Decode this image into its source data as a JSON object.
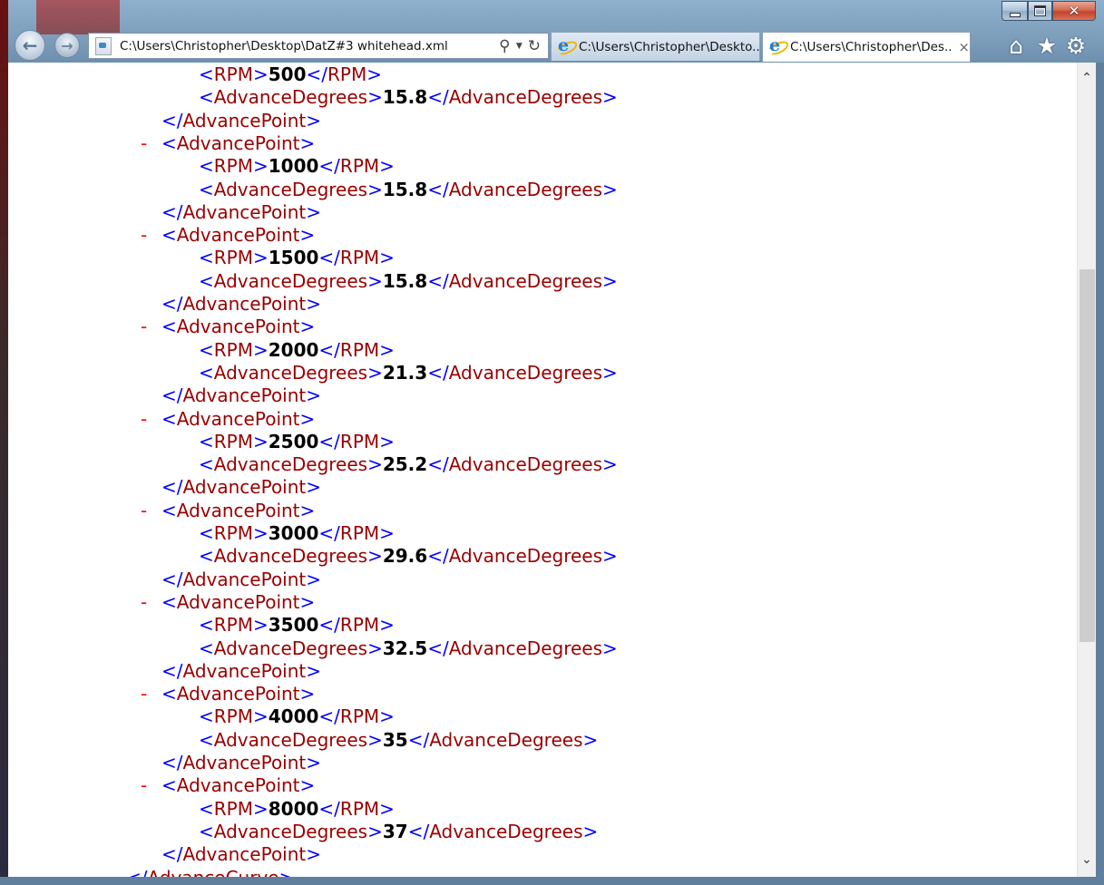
{
  "window": {
    "address": "C:\\Users\\Christopher\\Desktop\\DatZ#3 whitehead.xml",
    "close_glyph": "✕"
  },
  "tabs": [
    {
      "label": "C:\\Users\\Christopher\\Deskto...",
      "active": false
    },
    {
      "label": "C:\\Users\\Christopher\\Des...",
      "active": true
    }
  ],
  "toolbar": {
    "back_glyph": "←",
    "forward_glyph": "→",
    "home_glyph": "⌂",
    "favorites_glyph": "★",
    "tools_glyph": "⚙",
    "search_glyph": "⚲",
    "dropdown_glyph": "▼",
    "refresh_glyph": "↻",
    "tab_close_glyph": "×"
  },
  "scrollbar": {
    "up_glyph": "⌃",
    "down_glyph": "⌄"
  },
  "xml": {
    "first_rpm": "500",
    "first_deg": "15.8",
    "points": [
      {
        "rpm": "1000",
        "deg": "15.8"
      },
      {
        "rpm": "1500",
        "deg": "15.8"
      },
      {
        "rpm": "2000",
        "deg": "21.3"
      },
      {
        "rpm": "2500",
        "deg": "25.2"
      },
      {
        "rpm": "3000",
        "deg": "29.6"
      },
      {
        "rpm": "3500",
        "deg": "32.5"
      },
      {
        "rpm": "4000",
        "deg": "35"
      },
      {
        "rpm": "8000",
        "deg": "37"
      }
    ],
    "tag_point": "AdvancePoint",
    "tag_rpm": "RPM",
    "tag_deg": "AdvanceDegrees",
    "tag_curve": "AdvanceCurve",
    "collapse_glyph": "-"
  }
}
